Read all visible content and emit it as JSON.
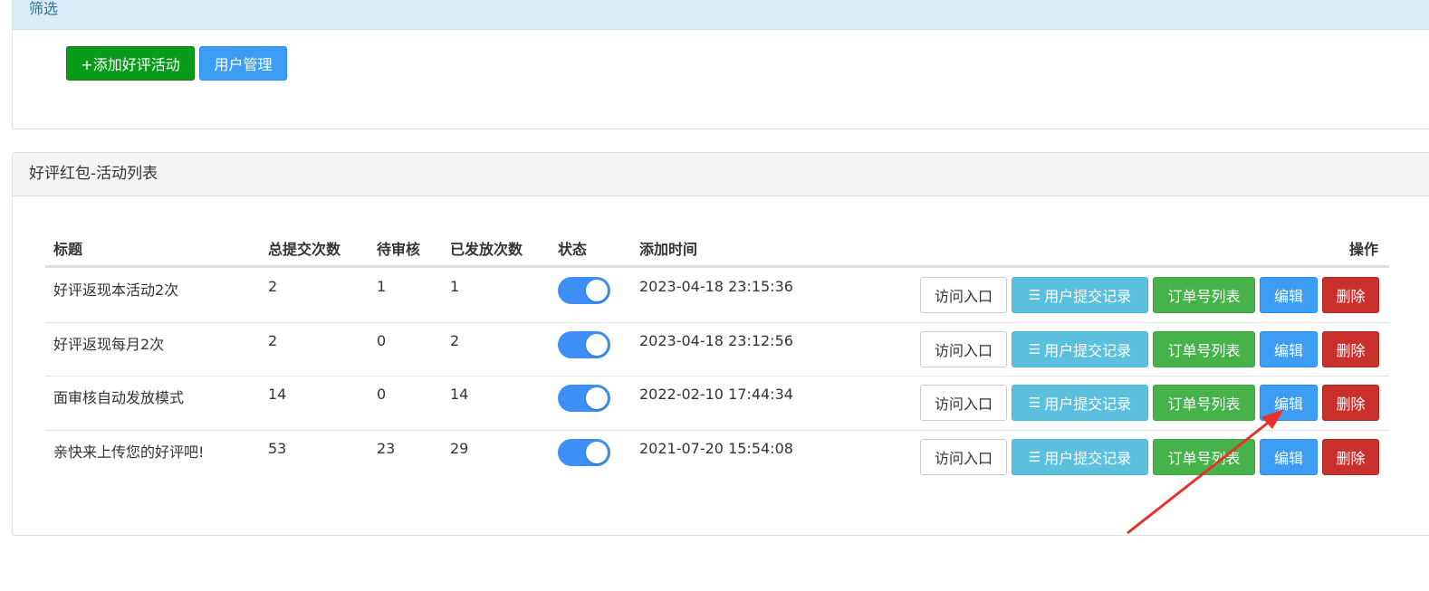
{
  "filter": {
    "title": "筛选",
    "add_button": "+添加好评活动",
    "users_button": "用户管理"
  },
  "list": {
    "title": "好评红包-活动列表",
    "columns": {
      "title": "标题",
      "total": "总提交次数",
      "pending": "待审核",
      "issued": "已发放次数",
      "status": "状态",
      "added": "添加时间",
      "actions": "操作"
    },
    "rows": [
      {
        "title": "好评返现本活动2次",
        "total": "2",
        "pending": "1",
        "issued": "1",
        "status_on": true,
        "added": "2023-04-18 23:15:36"
      },
      {
        "title": "好评返现每月2次",
        "total": "2",
        "pending": "0",
        "issued": "2",
        "status_on": true,
        "added": "2023-04-18 23:12:56"
      },
      {
        "title": "面审核自动发放模式",
        "total": "14",
        "pending": "0",
        "issued": "14",
        "status_on": true,
        "added": "2022-02-10 17:44:34"
      },
      {
        "title": "亲快来上传您的好评吧!",
        "total": "53",
        "pending": "23",
        "issued": "29",
        "status_on": true,
        "added": "2021-07-20 15:54:08"
      }
    ],
    "actions": {
      "visit": "访问入口",
      "log": "用户提交记录",
      "orders": "订单号列表",
      "edit": "编辑",
      "delete": "删除"
    }
  },
  "colors": {
    "add_button": "#0a9b1a",
    "primary": "#3d9df5",
    "info": "#5bc0de",
    "success": "#46b34a",
    "danger": "#c9302c",
    "toggle_on": "#3d8ff5",
    "annotation_arrow": "#e8312a"
  },
  "icons": {
    "log_button_icon": "list-icon"
  }
}
